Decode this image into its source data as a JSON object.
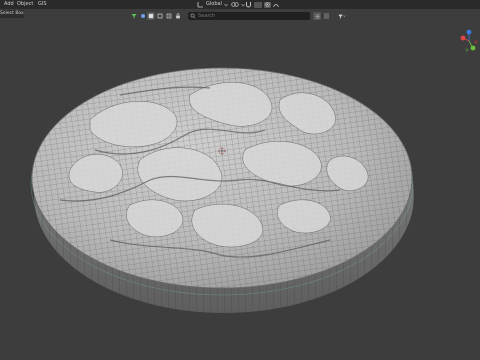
{
  "header": {
    "menus": [
      {
        "label": "Add"
      },
      {
        "label": "Object"
      },
      {
        "label": "GIS"
      }
    ],
    "transform_orientation": "Global",
    "select_box_label": "Select Box"
  },
  "outliner_search": {
    "placeholder": "Search"
  },
  "icons": {
    "orientation": "axes-icon",
    "snap": "magnet-icon",
    "proportional": "circle-dot-icon",
    "filter": "funnel-icon",
    "cursor": "3d-cursor-icon"
  },
  "colors": {
    "background": "#3d3d3d",
    "mesh_light": "#d2d2d2",
    "mesh_dark": "#5c5c5c",
    "gizmo_x": "#e04848",
    "gizmo_y": "#6dbd3a",
    "gizmo_z": "#3c78e0",
    "cursor": "#c43c3c"
  }
}
